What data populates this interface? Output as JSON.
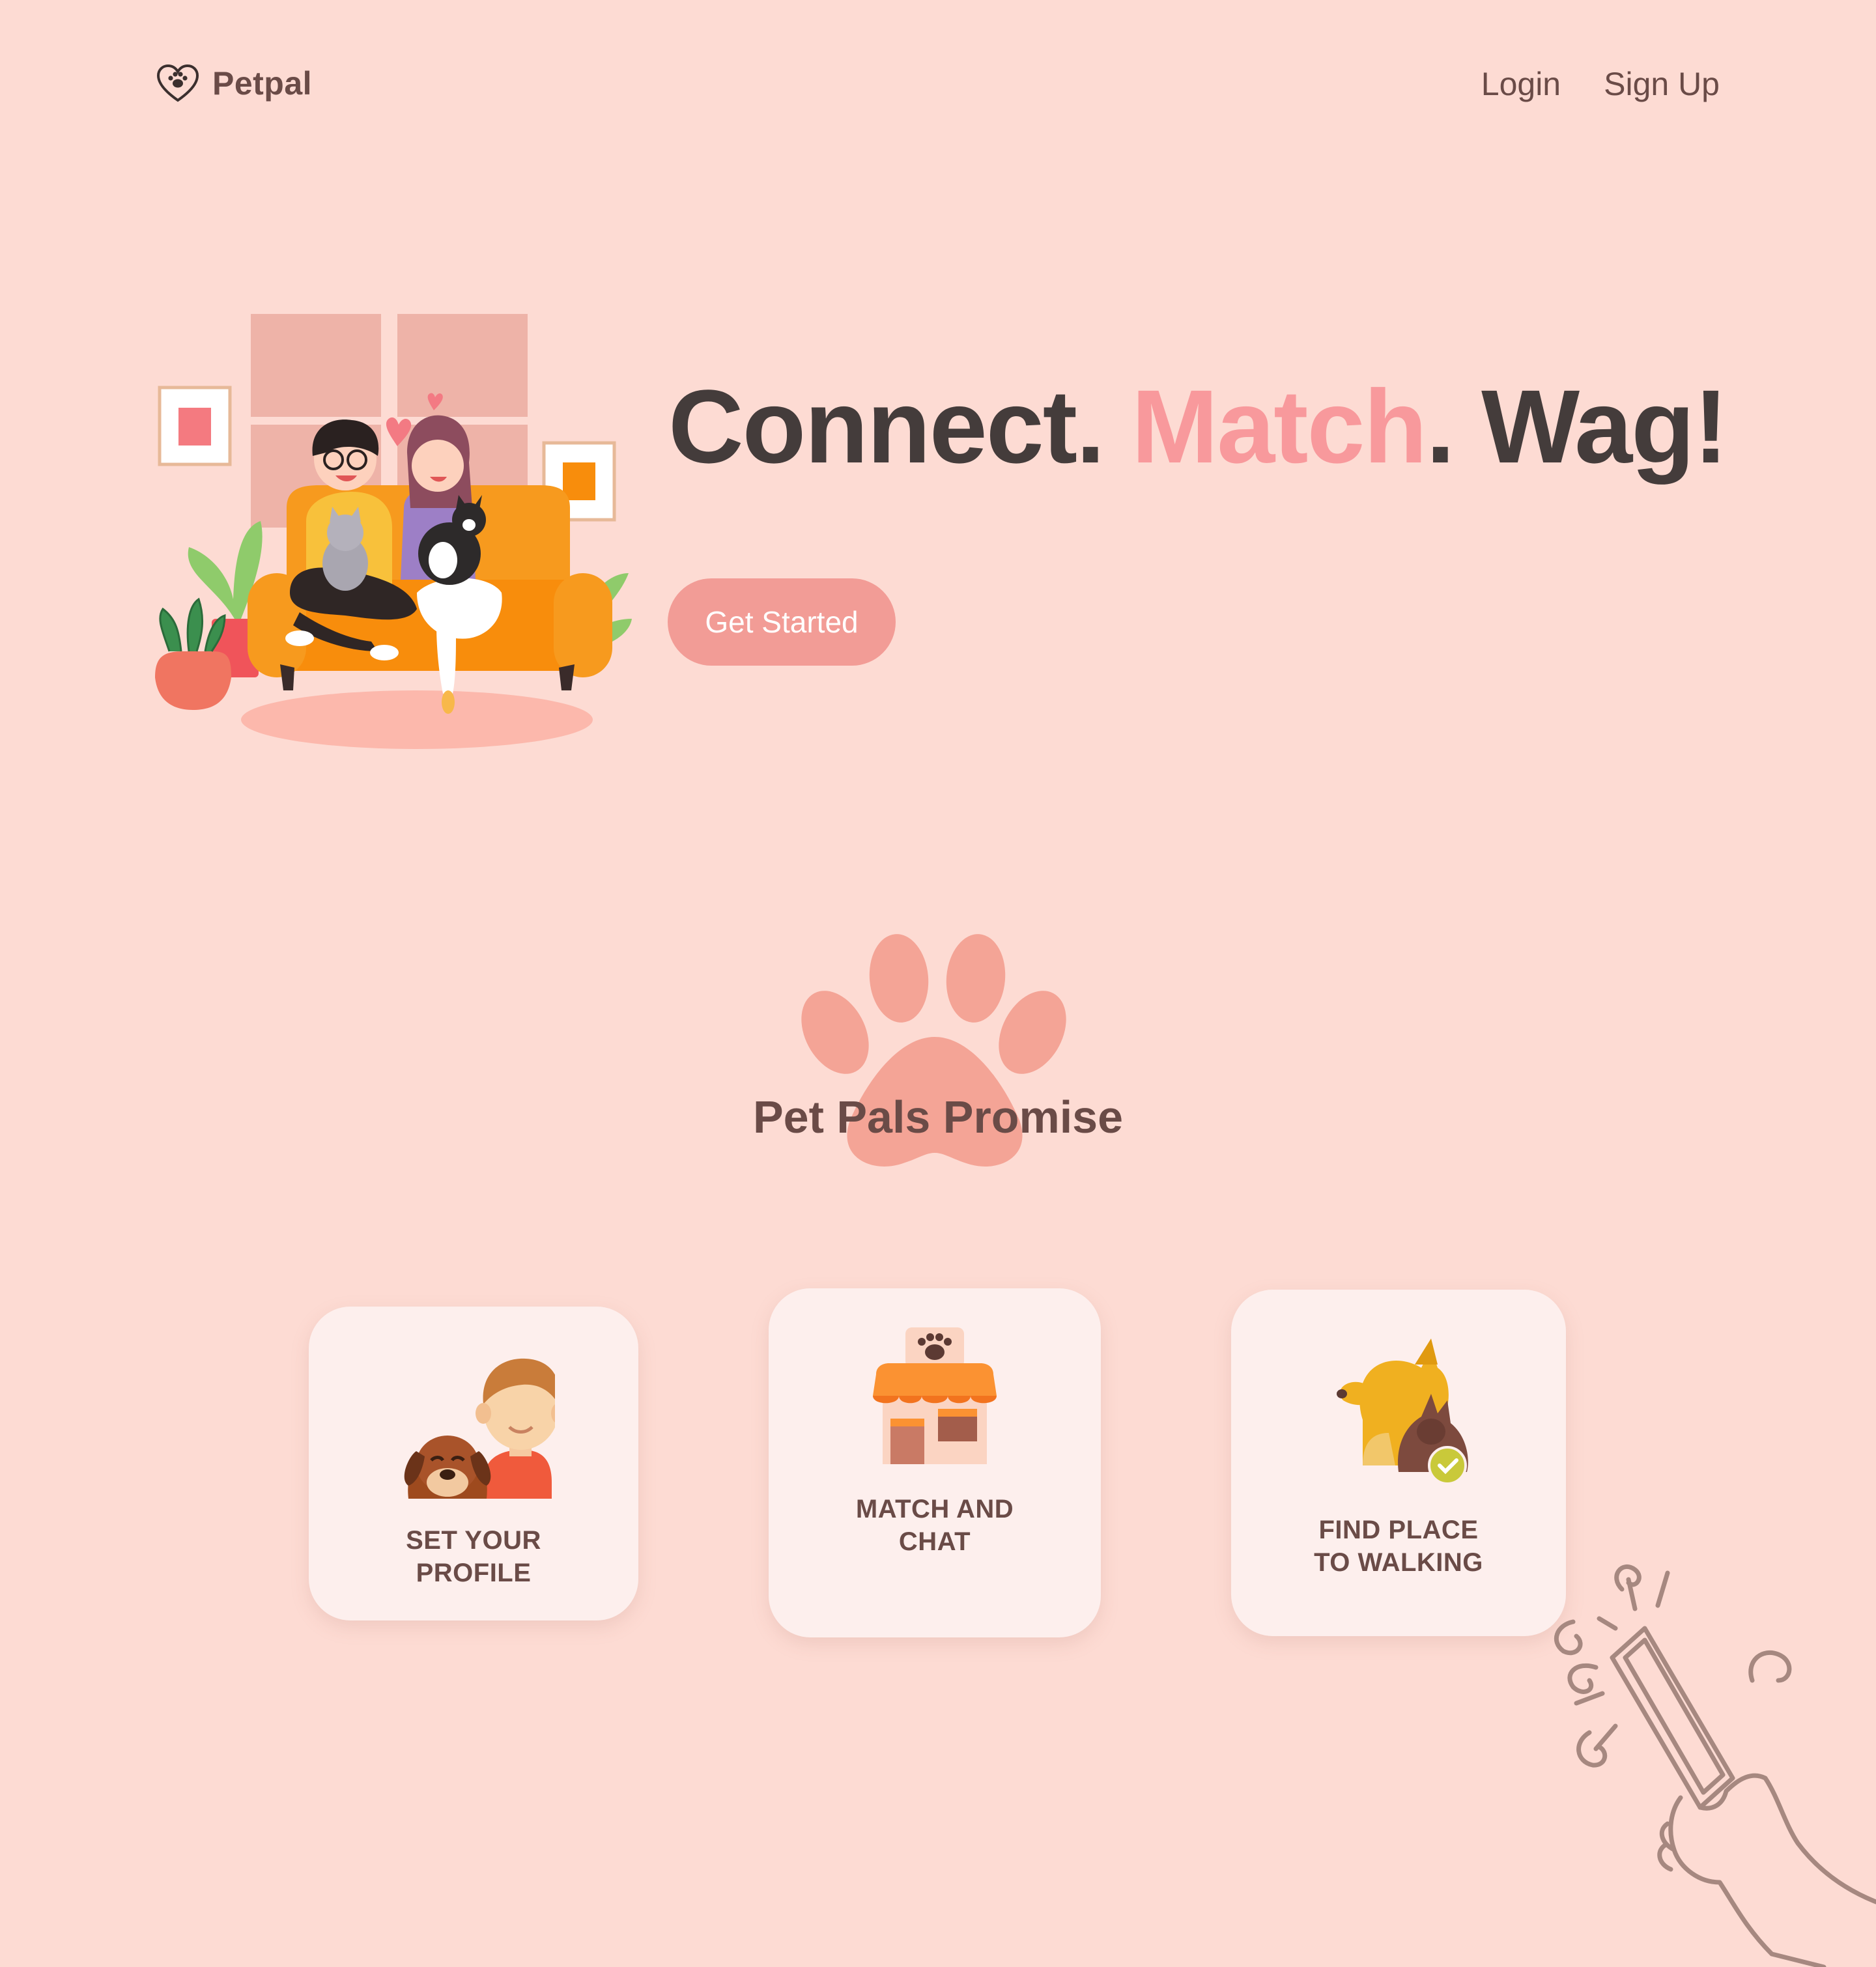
{
  "header": {
    "brand": "Petpal",
    "nav": [
      {
        "label": "Login"
      },
      {
        "label": "Sign Up"
      }
    ]
  },
  "hero": {
    "title_part1": "Connect. ",
    "title_accent": "Match",
    "title_part2": ". Wag!",
    "cta_label": "Get Started"
  },
  "promise": {
    "title": "Pet Pals Promise",
    "cards": [
      {
        "label": "SET YOUR\nPROFILE",
        "icon": "person-with-dog-icon"
      },
      {
        "label": "MATCH AND\nCHAT",
        "icon": "pet-shop-icon"
      },
      {
        "label": "FIND PLACE\nTO WALKING",
        "icon": "dog-and-cat-check-icon"
      }
    ]
  },
  "colors": {
    "background": "#fddbd3",
    "accent": "#f8999c",
    "button": "#f29c96",
    "text_dark": "#443c3b",
    "text_brown": "#6a4b47",
    "card": "#fdefed"
  }
}
